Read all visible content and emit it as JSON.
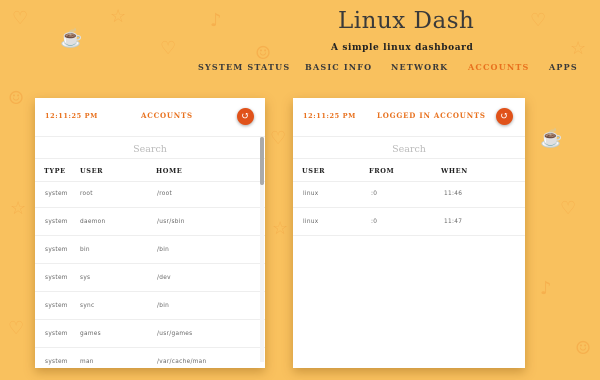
{
  "header": {
    "title": "Linux Dash",
    "subtitle": "A simple linux dashboard"
  },
  "nav": [
    {
      "label": "SYSTEM STATUS",
      "active": false
    },
    {
      "label": "BASIC INFO",
      "active": false
    },
    {
      "label": "NETWORK",
      "active": false
    },
    {
      "label": "ACCOUNTS",
      "active": true
    },
    {
      "label": "APPS",
      "active": false
    }
  ],
  "accounts_panel": {
    "time": "12:11:25 PM",
    "title": "ACCOUNTS",
    "search_placeholder": "Search",
    "columns": [
      "TYPE",
      "USER",
      "HOME"
    ],
    "rows": [
      {
        "type": "system",
        "user": "root",
        "home": "/root"
      },
      {
        "type": "system",
        "user": "daemon",
        "home": "/usr/sbin"
      },
      {
        "type": "system",
        "user": "bin",
        "home": "/bin"
      },
      {
        "type": "system",
        "user": "sys",
        "home": "/dev"
      },
      {
        "type": "system",
        "user": "sync",
        "home": "/bin"
      },
      {
        "type": "system",
        "user": "games",
        "home": "/usr/games"
      },
      {
        "type": "system",
        "user": "man",
        "home": "/var/cache/man"
      }
    ]
  },
  "logged_panel": {
    "time": "12:11:25 PM",
    "title": "LOGGED IN ACCOUNTS",
    "search_placeholder": "Search",
    "columns": [
      "USER",
      "FROM",
      "WHEN"
    ],
    "rows": [
      {
        "user": "linux",
        "from": ":0",
        "when": "11:46"
      },
      {
        "user": "linux",
        "from": ":0",
        "when": "11:47"
      }
    ]
  },
  "icons": {
    "refresh": "refresh-icon"
  },
  "colors": {
    "background": "#f9c15e",
    "accent": "#e8711e",
    "refresh_button": "#e0521a",
    "panel": "#ffffff"
  }
}
